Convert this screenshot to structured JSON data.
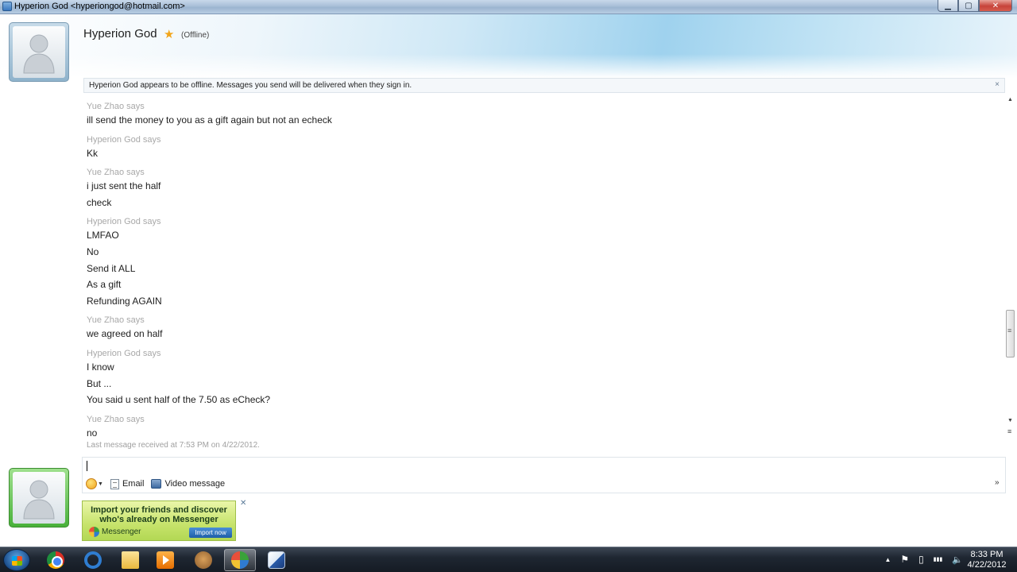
{
  "window": {
    "title": "Hyperion God <hyperiongod@hotmail.com>",
    "controls": {
      "minimize": "▁",
      "maximize": "▢",
      "close": "✕"
    }
  },
  "contact": {
    "name": "Hyperion God",
    "status": "(Offline)",
    "favorite_icon": "star-icon"
  },
  "infobar": {
    "text": "Hyperion God appears to be offline. Messages you send will be delivered when they sign in.",
    "close": "×"
  },
  "conversation": [
    {
      "type": "says",
      "text": "Yue Zhao says"
    },
    {
      "type": "msg",
      "text": "ill send the money to you as a gift again but not an echeck"
    },
    {
      "type": "says",
      "text": "Hyperion God says"
    },
    {
      "type": "msg",
      "text": "Kk"
    },
    {
      "type": "says",
      "text": "Yue Zhao says"
    },
    {
      "type": "msg",
      "text": "i just sent the half"
    },
    {
      "type": "msg",
      "text": "check"
    },
    {
      "type": "says",
      "text": "Hyperion God says"
    },
    {
      "type": "msg",
      "text": "LMFAO"
    },
    {
      "type": "msg",
      "text": "No"
    },
    {
      "type": "msg",
      "text": "Send it ALL"
    },
    {
      "type": "msg",
      "text": "As a gift"
    },
    {
      "type": "msg",
      "text": "Refunding AGAIN"
    },
    {
      "type": "says",
      "text": "Yue Zhao says"
    },
    {
      "type": "msg",
      "text": "we agreed on half"
    },
    {
      "type": "says",
      "text": "Hyperion God says"
    },
    {
      "type": "msg",
      "text": "I know"
    },
    {
      "type": "msg",
      "text": "But ..."
    },
    {
      "type": "msg",
      "text": "You said u sent half of the 7.50 as eCheck?"
    },
    {
      "type": "says",
      "text": "Yue Zhao says"
    },
    {
      "type": "msg",
      "text": "no"
    },
    {
      "type": "last",
      "text": "Last message received at 7:53 PM on 4/22/2012."
    }
  ],
  "compose": {
    "value": "",
    "toolbar": {
      "email_label": "Email",
      "video_label": "Video message",
      "more": "»"
    }
  },
  "ad": {
    "line1": "Import your friends and discover",
    "line2": "who's already on Messenger",
    "brand": "Messenger",
    "button": "Import now",
    "close": "✕"
  },
  "taskbar": {
    "apps": [
      "chrome-icon",
      "internet-explorer-icon",
      "folder-icon",
      "media-player-icon",
      "gimp-icon",
      "messenger-icon",
      "paint-icon"
    ],
    "tray": {
      "up": "▲",
      "flag": "⚑",
      "network": "▮▮▮",
      "volume": "🔈"
    },
    "time": "8:33 PM",
    "date": "4/22/2012"
  }
}
